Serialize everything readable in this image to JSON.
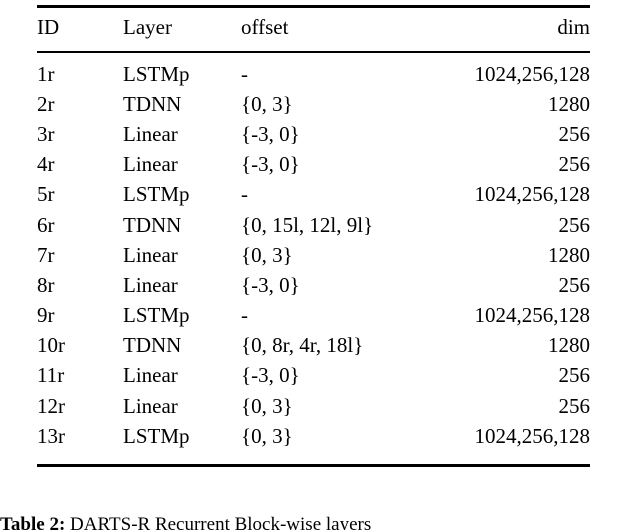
{
  "table": {
    "columns": [
      {
        "key": "id",
        "label": "ID",
        "align": "left"
      },
      {
        "key": "layer",
        "label": "Layer",
        "align": "left"
      },
      {
        "key": "offset",
        "label": "offset",
        "align": "left"
      },
      {
        "key": "dim",
        "label": "dim",
        "align": "right"
      }
    ],
    "rows": [
      {
        "id": "1r",
        "layer": "LSTMp",
        "offset": "-",
        "dim": "1024,256,128"
      },
      {
        "id": "2r",
        "layer": "TDNN",
        "offset": "{0, 3}",
        "dim": "1280"
      },
      {
        "id": "3r",
        "layer": "Linear",
        "offset": "{-3, 0}",
        "dim": "256"
      },
      {
        "id": "4r",
        "layer": "Linear",
        "offset": "{-3, 0}",
        "dim": "256"
      },
      {
        "id": "5r",
        "layer": "LSTMp",
        "offset": "-",
        "dim": "1024,256,128"
      },
      {
        "id": "6r",
        "layer": "TDNN",
        "offset": "{0, 15l, 12l, 9l}",
        "dim": "256"
      },
      {
        "id": "7r",
        "layer": "Linear",
        "offset": "{0, 3}",
        "dim": "1280"
      },
      {
        "id": "8r",
        "layer": "Linear",
        "offset": "{-3, 0}",
        "dim": "256"
      },
      {
        "id": "9r",
        "layer": "LSTMp",
        "offset": "-",
        "dim": "1024,256,128"
      },
      {
        "id": "10r",
        "layer": "TDNN",
        "offset": "{0, 8r, 4r, 18l}",
        "dim": "1280"
      },
      {
        "id": "11r",
        "layer": "Linear",
        "offset": "{-3, 0}",
        "dim": "256"
      },
      {
        "id": "12r",
        "layer": "Linear",
        "offset": "{0, 3}",
        "dim": "256"
      },
      {
        "id": "13r",
        "layer": "LSTMp",
        "offset": "{0, 3}",
        "dim": "1024,256,128"
      }
    ]
  },
  "caption": {
    "label": "Table 2:",
    "text": "DARTS-R Recurrent Block-wise layers"
  }
}
